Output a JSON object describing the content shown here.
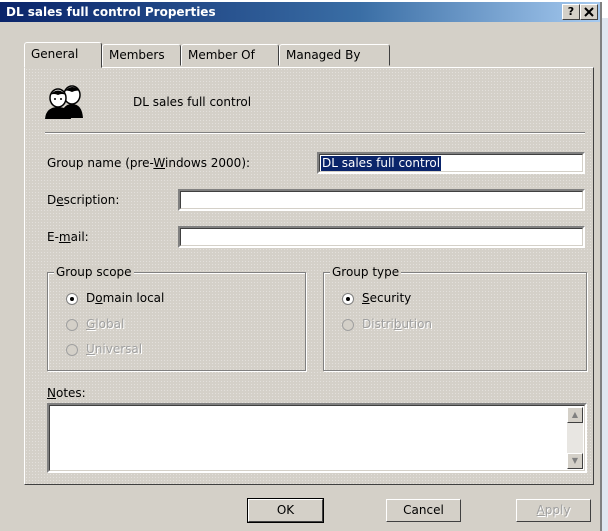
{
  "window": {
    "title": "DL sales full control Properties",
    "help_button": "?",
    "close_button": "x"
  },
  "tabs": [
    {
      "label": "General",
      "active": true
    },
    {
      "label": "Members",
      "active": false
    },
    {
      "label": "Member Of",
      "active": false
    },
    {
      "label": "Managed By",
      "active": false
    }
  ],
  "general": {
    "group_display_name": "DL sales full control",
    "group_name_label": "Group name (pre-Windows 2000):",
    "group_name_value": "DL sales full control",
    "description_label": "Description:",
    "description_value": "",
    "email_label": "E-mail:",
    "email_value": "",
    "group_scope": {
      "title": "Group scope",
      "options": [
        {
          "label": "Domain local",
          "checked": true,
          "enabled": true
        },
        {
          "label": "Global",
          "checked": false,
          "enabled": false
        },
        {
          "label": "Universal",
          "checked": false,
          "enabled": false
        }
      ]
    },
    "group_type": {
      "title": "Group type",
      "options": [
        {
          "label": "Security",
          "checked": true,
          "enabled": true
        },
        {
          "label": "Distribution",
          "checked": false,
          "enabled": false
        }
      ]
    },
    "notes_label": "Notes:",
    "notes_value": ""
  },
  "buttons": {
    "ok": "OK",
    "cancel": "Cancel",
    "apply": "Apply"
  },
  "icons": {
    "group": "group-users-icon"
  },
  "colors": {
    "title_start": "#0a246a",
    "title_end": "#a6caf0",
    "selection": "#0a246a",
    "face": "#d4d0c8"
  }
}
